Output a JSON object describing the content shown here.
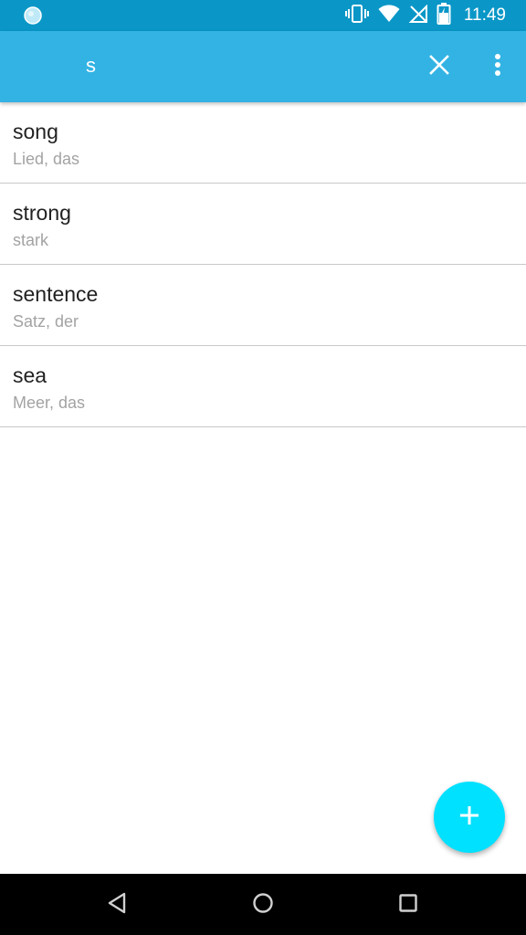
{
  "status_bar": {
    "time": "11:49",
    "icons": [
      "notification-dot-icon",
      "vibrate-icon",
      "wifi-icon",
      "no-sim-icon",
      "battery-icon"
    ]
  },
  "app_bar": {
    "search_value": "s",
    "clear_icon": "close-icon",
    "menu_icon": "more-vert-icon"
  },
  "results": [
    {
      "word": "song",
      "translation": "Lied, das"
    },
    {
      "word": "strong",
      "translation": "stark"
    },
    {
      "word": "sentence",
      "translation": "Satz, der"
    },
    {
      "word": "sea",
      "translation": "Meer, das"
    }
  ],
  "fab": {
    "icon": "add-icon"
  },
  "nav_bar": {
    "icons": [
      "back-icon",
      "home-icon",
      "recents-icon"
    ]
  },
  "colors": {
    "status_bar": "#0a97c7",
    "app_bar": "#32b3e4",
    "fab": "#00e0ff",
    "word_text": "#212121",
    "translation_text": "#a3a3a3"
  }
}
